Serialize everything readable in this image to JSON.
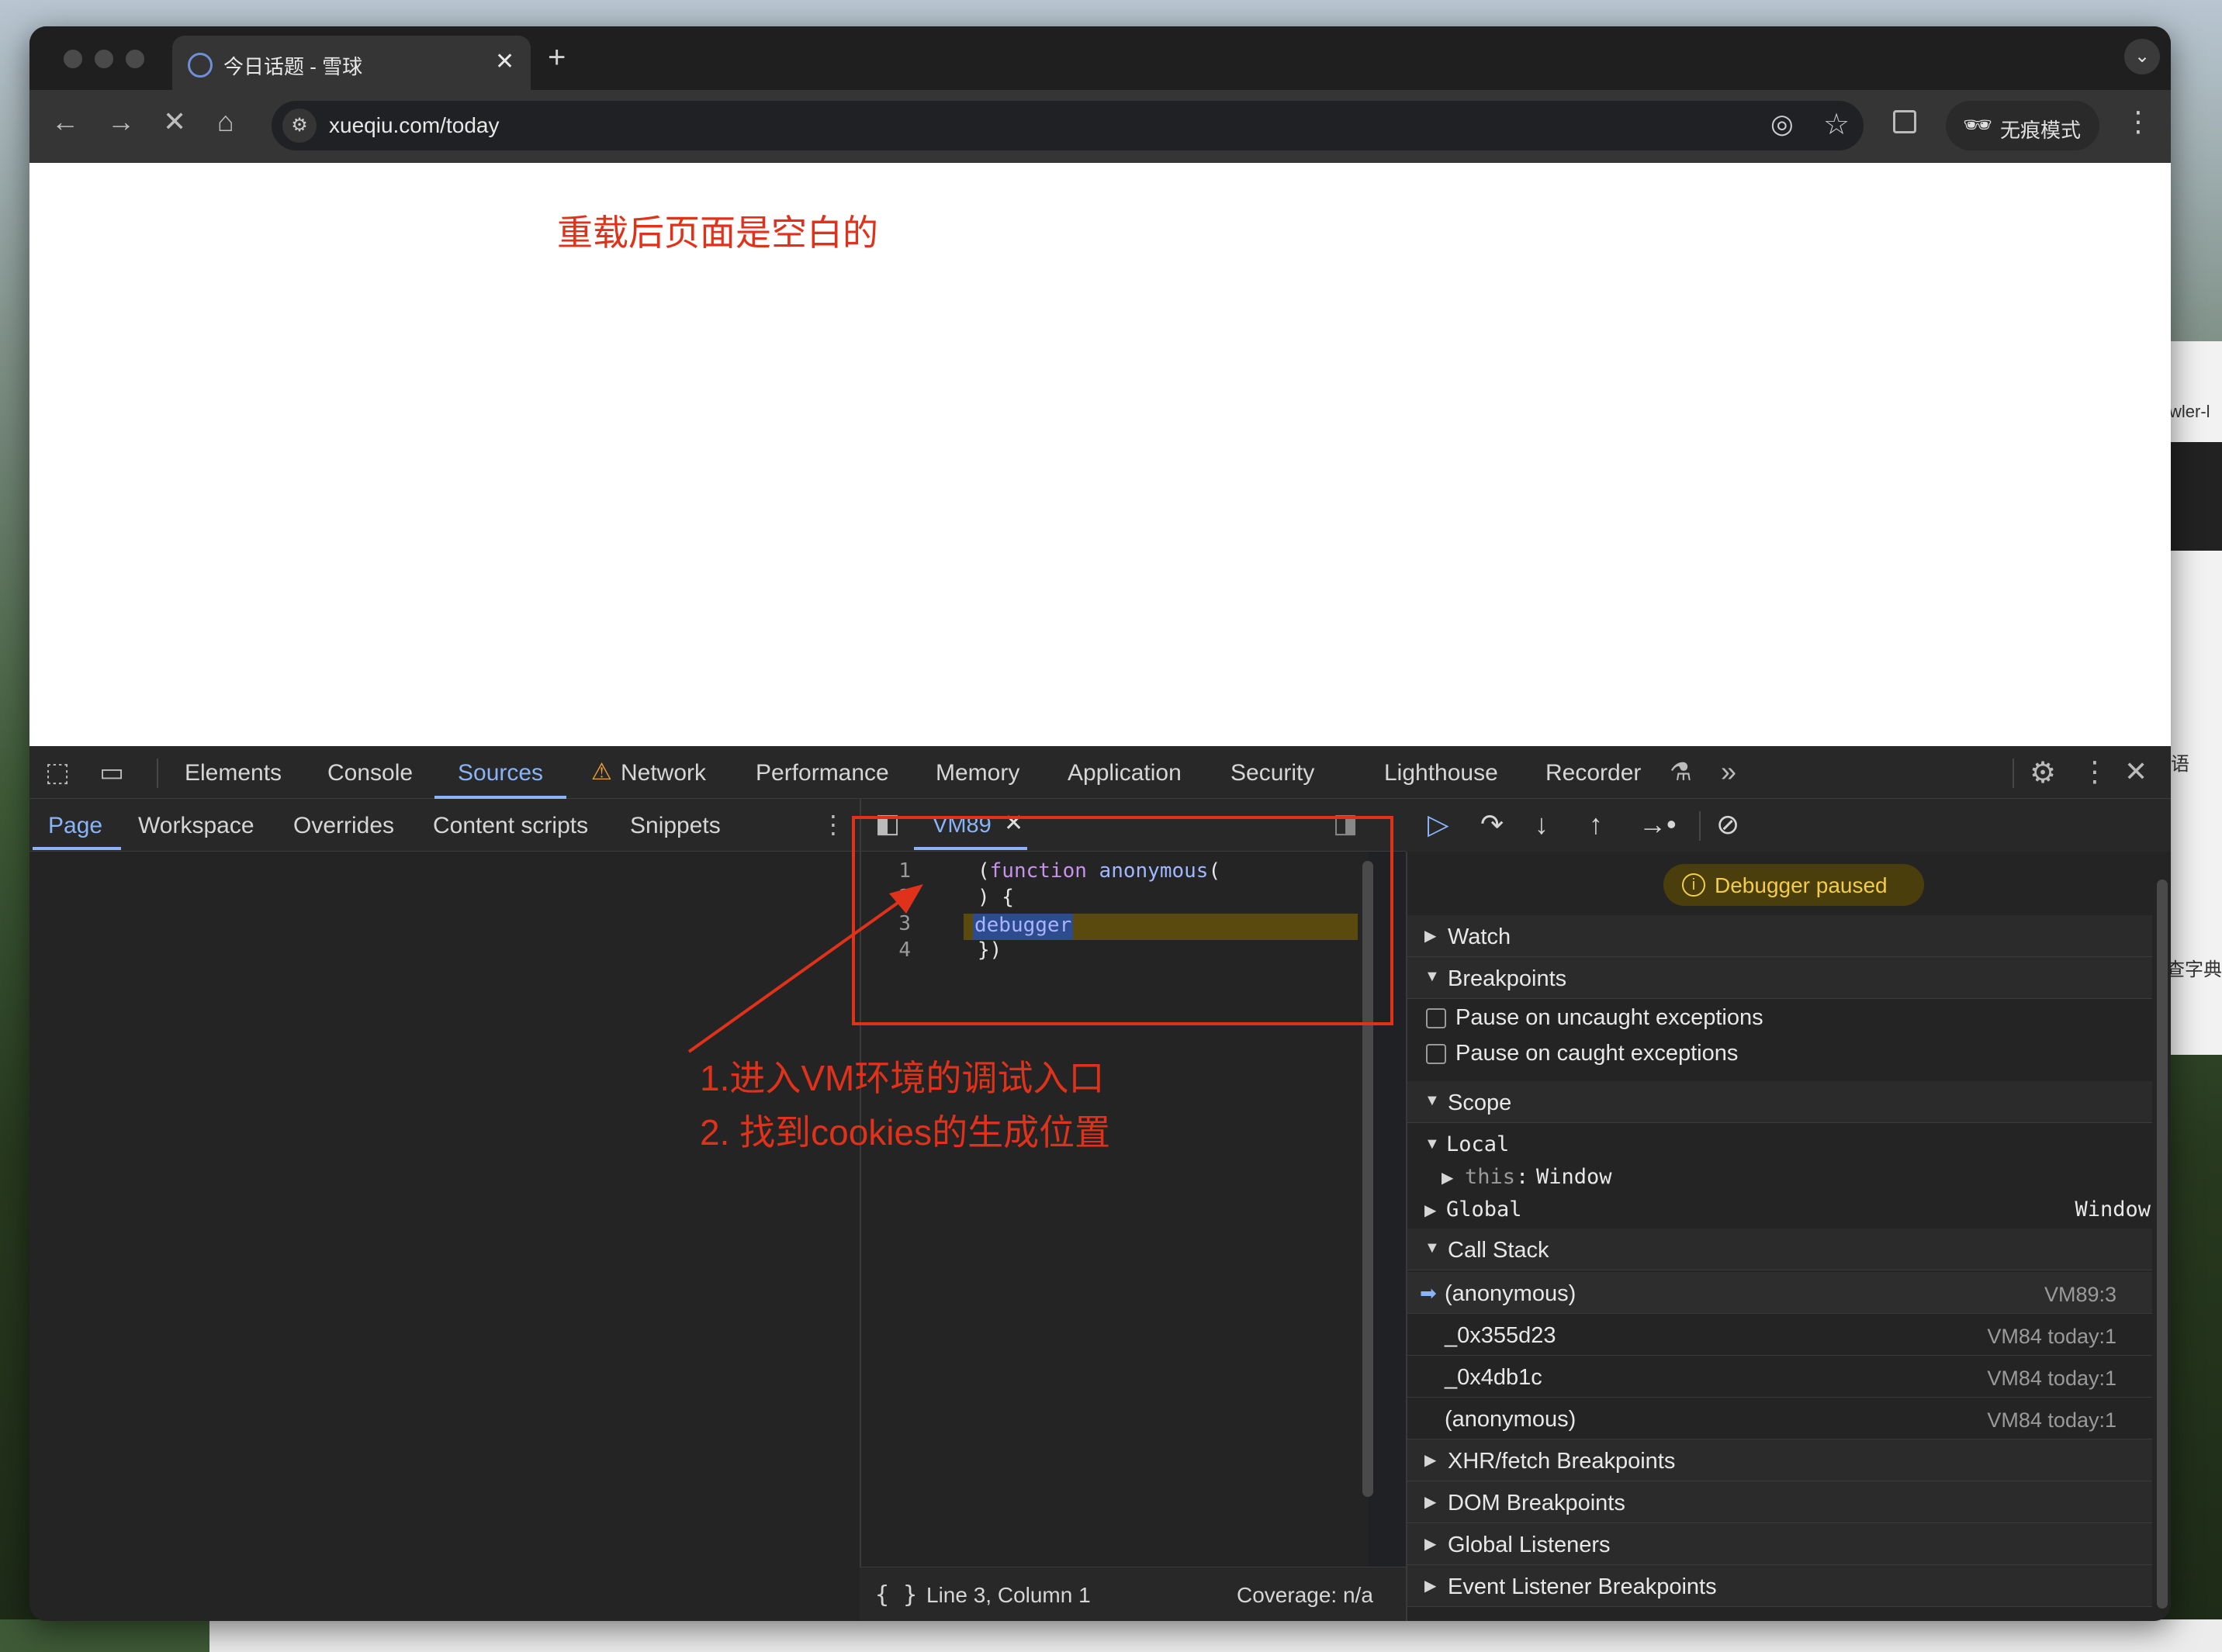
{
  "desktop": {
    "right_text_1": "wler-l",
    "right_text_2": "语",
    "right_text_3": "查字典"
  },
  "browser": {
    "tab": {
      "title": "今日话题 - 雪球",
      "close": "✕"
    },
    "new_tab": "+",
    "tab_menu": "⌄",
    "url": "xueqiu.com/today",
    "incognito_label": "无痕模式"
  },
  "page": {
    "annotation": "重载后页面是空白的"
  },
  "devtools": {
    "tabs": [
      "Elements",
      "Console",
      "Sources",
      "Network",
      "Performance",
      "Memory",
      "Application",
      "Security",
      "Lighthouse",
      "Recorder"
    ],
    "active_tab": "Sources",
    "sources_tabs": [
      "Page",
      "Workspace",
      "Overrides",
      "Content scripts",
      "Snippets"
    ],
    "active_sources_tab": "Page",
    "file_tab": "VM89",
    "code_lines": [
      {
        "n": "1",
        "text": "(function anonymous("
      },
      {
        "n": "2",
        "text": ") {"
      },
      {
        "n": "3",
        "text": "debugger"
      },
      {
        "n": "4",
        "text": "})"
      }
    ],
    "code_kw": "function",
    "code_fn": "anonymous",
    "status_position": "Line 3, Column 1",
    "status_coverage": "Coverage: n/a",
    "debugger_paused": "Debugger paused",
    "sections": {
      "watch": "Watch",
      "breakpoints": "Breakpoints",
      "scope": "Scope",
      "call_stack": "Call Stack",
      "xhr": "XHR/fetch Breakpoints",
      "dom": "DOM Breakpoints",
      "global_listeners": "Global Listeners",
      "event_listener": "Event Listener Breakpoints"
    },
    "breakpoint_options": [
      "Pause on uncaught exceptions",
      "Pause on caught exceptions"
    ],
    "scope": {
      "local": "Local",
      "this_key": "this",
      "this_value": "Window",
      "global": "Global",
      "global_value": "Window"
    },
    "call_stack": [
      {
        "name": "(anonymous)",
        "location": "VM89:3",
        "current": true
      },
      {
        "name": "_0x355d23",
        "location": "VM84 today:1",
        "current": false
      },
      {
        "name": "_0x4db1c",
        "location": "VM84 today:1",
        "current": false
      },
      {
        "name": "(anonymous)",
        "location": "VM84 today:1",
        "current": false
      }
    ]
  },
  "annotations": {
    "line1": "1.进入VM环境的调试入口",
    "line2": "2. 找到cookies的生成位置",
    "color": "#e0321b"
  }
}
